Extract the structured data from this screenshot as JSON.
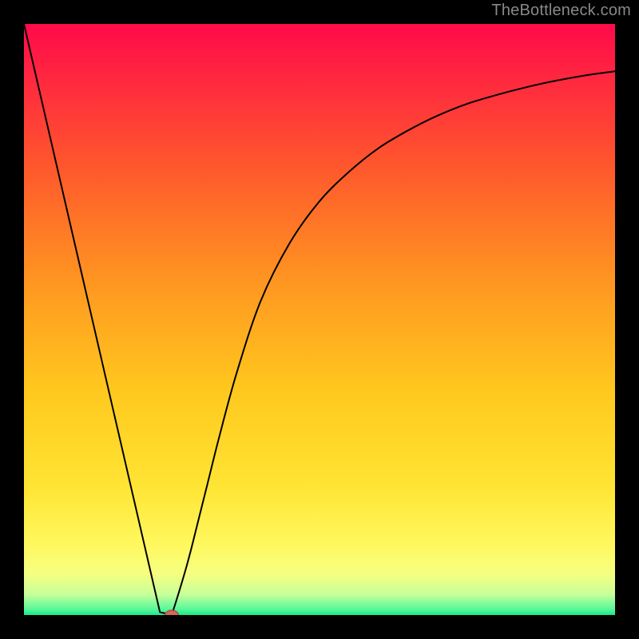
{
  "watermark": "TheBottleneck.com",
  "colors": {
    "bg": "#000000",
    "curve": "#000000",
    "marker_fill": "#d46a5a",
    "marker_stroke": "#b24b3d",
    "gradient_stops": [
      {
        "offset": 0.0,
        "color": "#ff0a4a"
      },
      {
        "offset": 0.1,
        "color": "#ff2a3e"
      },
      {
        "offset": 0.25,
        "color": "#ff5a2c"
      },
      {
        "offset": 0.45,
        "color": "#ff9a20"
      },
      {
        "offset": 0.62,
        "color": "#ffc81e"
      },
      {
        "offset": 0.78,
        "color": "#ffe433"
      },
      {
        "offset": 0.88,
        "color": "#fff85e"
      },
      {
        "offset": 0.93,
        "color": "#f6ff80"
      },
      {
        "offset": 0.965,
        "color": "#c8ff9a"
      },
      {
        "offset": 0.99,
        "color": "#58f89a"
      },
      {
        "offset": 1.0,
        "color": "#18e888"
      }
    ]
  },
  "chart_data": {
    "type": "line",
    "title": "",
    "xlabel": "",
    "ylabel": "",
    "xlim": [
      0,
      100
    ],
    "ylim": [
      0,
      100
    ],
    "grid": false,
    "left_line": {
      "description": "straight descending segment from top-left to valley",
      "points": [
        {
          "x": 0,
          "y": 100
        },
        {
          "x": 23,
          "y": 0.5
        }
      ]
    },
    "right_curve": {
      "description": "rising saturating curve from valley toward upper-right",
      "points": [
        {
          "x": 25,
          "y": 0
        },
        {
          "x": 27,
          "y": 6
        },
        {
          "x": 29,
          "y": 14
        },
        {
          "x": 31,
          "y": 22
        },
        {
          "x": 33,
          "y": 30
        },
        {
          "x": 36,
          "y": 41
        },
        {
          "x": 40,
          "y": 53
        },
        {
          "x": 45,
          "y": 63
        },
        {
          "x": 50,
          "y": 70
        },
        {
          "x": 55,
          "y": 75
        },
        {
          "x": 60,
          "y": 79
        },
        {
          "x": 65,
          "y": 82
        },
        {
          "x": 70,
          "y": 84.5
        },
        {
          "x": 75,
          "y": 86.5
        },
        {
          "x": 80,
          "y": 88
        },
        {
          "x": 85,
          "y": 89.3
        },
        {
          "x": 90,
          "y": 90.4
        },
        {
          "x": 95,
          "y": 91.3
        },
        {
          "x": 100,
          "y": 92
        }
      ]
    },
    "valley_bottom": {
      "description": "short flat segment at valley floor",
      "points": [
        {
          "x": 23,
          "y": 0.5
        },
        {
          "x": 25,
          "y": 0
        }
      ]
    },
    "marker": {
      "x": 25,
      "y": 0,
      "rx": 1.1,
      "ry": 0.8
    }
  }
}
